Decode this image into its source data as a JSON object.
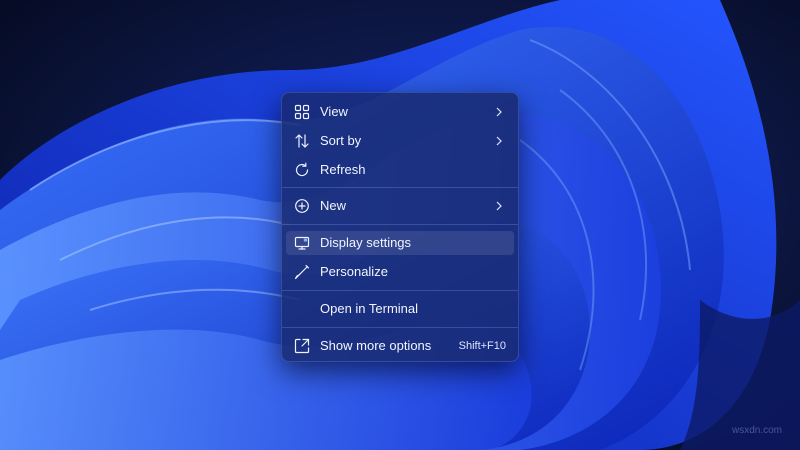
{
  "desktop": {
    "wallpaper": "windows-11-bloom"
  },
  "context_menu": {
    "items": [
      {
        "label": "View",
        "icon": "grid-icon",
        "submenu": true
      },
      {
        "label": "Sort by",
        "icon": "sort-icon",
        "submenu": true
      },
      {
        "label": "Refresh",
        "icon": "refresh-icon"
      },
      {
        "label": "New",
        "icon": "plus-circle-icon",
        "submenu": true
      },
      {
        "label": "Display settings",
        "icon": "display-icon",
        "highlighted": true
      },
      {
        "label": "Personalize",
        "icon": "brush-icon"
      },
      {
        "label": "Open in Terminal",
        "icon": ""
      },
      {
        "label": "Show more options",
        "icon": "expand-icon",
        "shortcut": "Shift+F10"
      }
    ]
  },
  "watermark": "wsxdn.com",
  "colors": {
    "menu_background": "#182a70",
    "text": "#f2f5ff",
    "wallpaper_blue": "#1f4cf0"
  }
}
